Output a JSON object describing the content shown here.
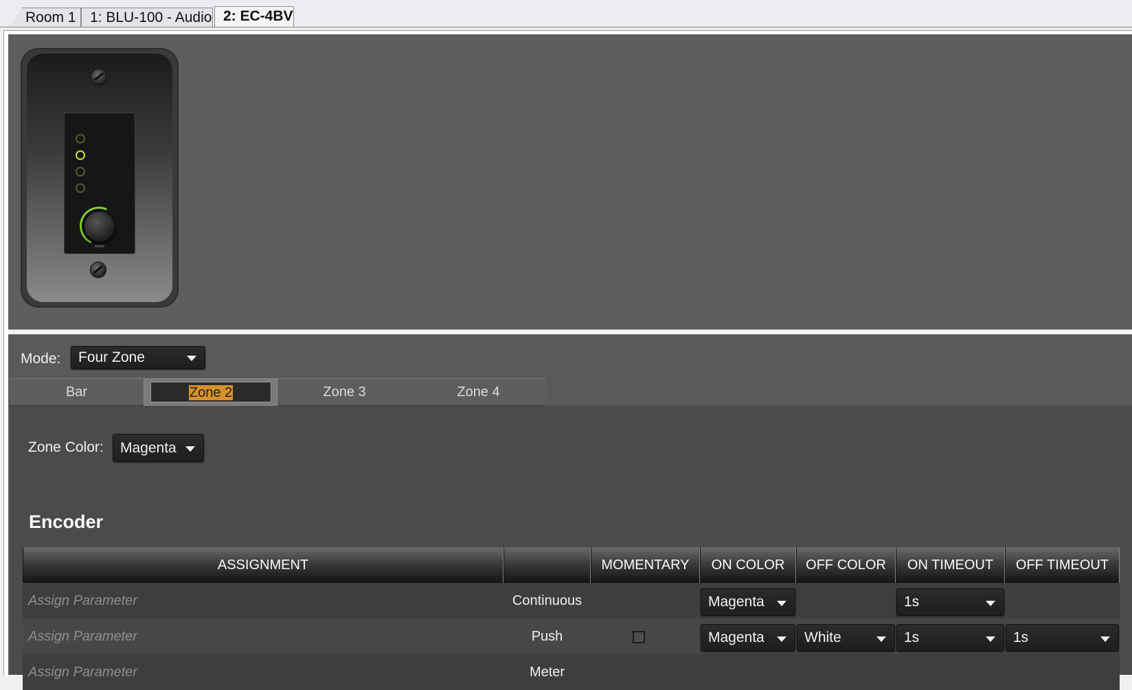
{
  "doc_tabs": [
    {
      "label": "Room 1"
    },
    {
      "label": "1: BLU-100 - Audio"
    },
    {
      "label": "2: EC-4BV"
    }
  ],
  "mode": {
    "label": "Mode:",
    "value": "Four Zone"
  },
  "zone_tabs": [
    {
      "label": "Bar",
      "active": false
    },
    {
      "label": "Zone 2",
      "active": true
    },
    {
      "label": "Zone 3",
      "active": false
    },
    {
      "label": "Zone 4",
      "active": false
    }
  ],
  "zone_color": {
    "label": "Zone Color:",
    "value": "Magenta"
  },
  "encoder": {
    "title": "Encoder",
    "columns": [
      "ASSIGNMENT",
      "",
      "MOMENTARY",
      "ON COLOR",
      "OFF COLOR",
      "ON TIMEOUT",
      "OFF TIMEOUT"
    ],
    "rows": [
      {
        "assignment": "Assign Parameter",
        "control": "Continuous",
        "on_color": "Magenta",
        "off_color": "",
        "on_timeout": "1s",
        "off_timeout": ""
      },
      {
        "assignment": "Assign Parameter",
        "control": "Push",
        "momentary": false,
        "on_color": "Magenta",
        "off_color": "White",
        "on_timeout": "1s",
        "off_timeout": "1s"
      },
      {
        "assignment": "Assign Parameter",
        "control": "Meter"
      }
    ]
  },
  "device": {
    "leds": [
      {
        "on": false
      },
      {
        "on": true
      },
      {
        "on": false
      },
      {
        "on": false
      }
    ]
  },
  "colors": {
    "accent_highlight": "#d69128",
    "led_active": "#c7df3a",
    "led_inactive": "#575a2f",
    "knob_ring": "#7ecf2a"
  }
}
